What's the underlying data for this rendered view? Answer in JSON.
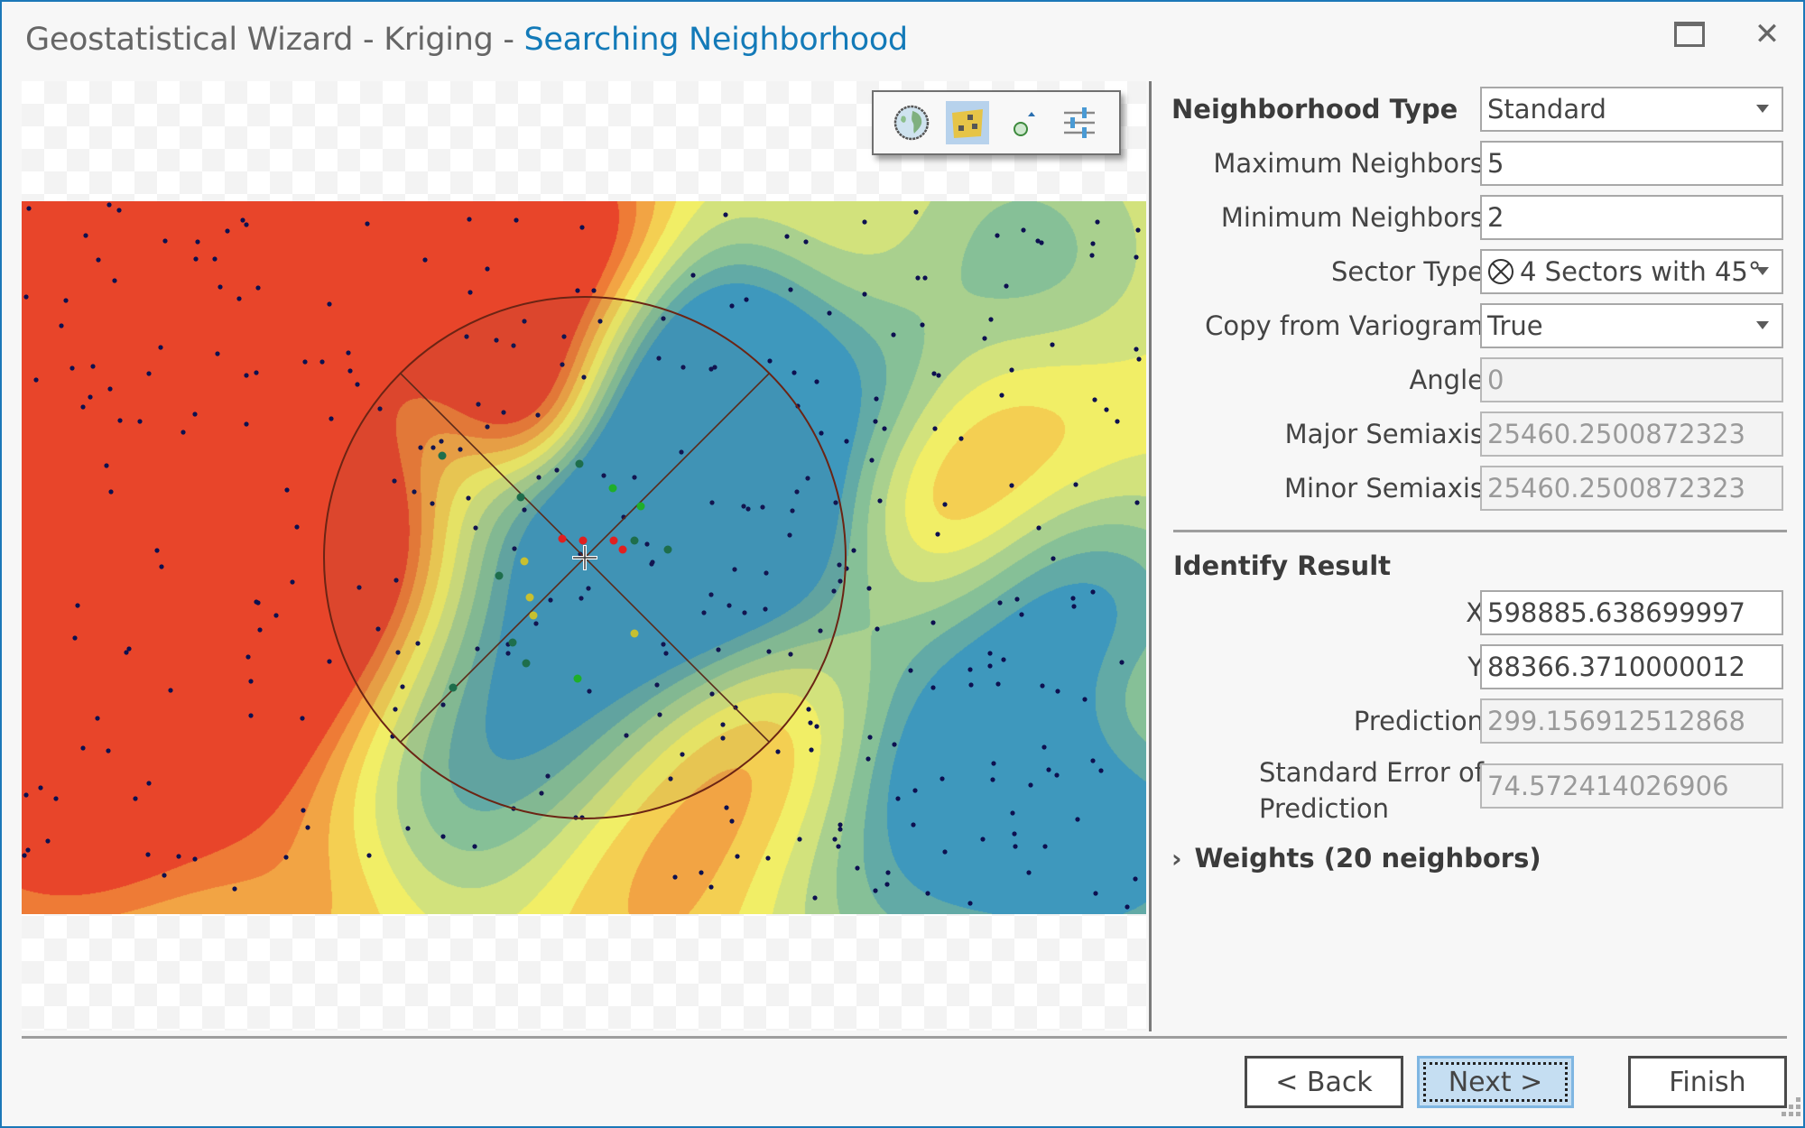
{
  "window": {
    "title_prefix": "Geostatistical Wizard - Kriging - ",
    "title_step": "Searching Neighborhood",
    "maximize_icon": "maximize-icon",
    "close_icon": "close-icon",
    "close_glyph": "✕"
  },
  "map_toolbar": {
    "buttons": [
      {
        "name": "full-extent-button",
        "icon": "globe-icon",
        "active": false
      },
      {
        "name": "show-points-button",
        "icon": "points-layer-icon",
        "active": true
      },
      {
        "name": "identify-location-button",
        "icon": "point-identify-icon",
        "active": false
      },
      {
        "name": "map-settings-button",
        "icon": "sliders-icon",
        "active": false
      }
    ]
  },
  "map": {
    "crosshair": "identify-crosshair",
    "search_shape": "circle",
    "sectors": 4,
    "sector_angle_deg": 45,
    "neighbor_point_colors": {
      "highest_weight": "#e02020",
      "high_weight": "#1fae2a",
      "medium_weight": "#1e6e4c",
      "low_weight": "#c8c030",
      "sample_point": "#0d1050"
    },
    "colormap": [
      "#e8452a",
      "#ee7b36",
      "#f2a444",
      "#f4cf52",
      "#f1ee66",
      "#d2e27c",
      "#a9d08e",
      "#86c097",
      "#62aaa6",
      "#3e98bd"
    ]
  },
  "form": {
    "neighborhood_type": {
      "label": "Neighborhood Type",
      "value": "Standard"
    },
    "max_neighbors": {
      "label": "Maximum Neighbors",
      "value": "5"
    },
    "min_neighbors": {
      "label": "Minimum Neighbors",
      "value": "2"
    },
    "sector_type": {
      "label": "Sector Type",
      "value": "4 Sectors with 45°",
      "icon": "sector-4-45-icon"
    },
    "copy_from_variogram": {
      "label": "Copy from Variogram",
      "value": "True"
    },
    "angle": {
      "label": "Angle",
      "value": "0"
    },
    "major_semiaxis": {
      "label": "Major Semiaxis",
      "value": "25460.2500872323"
    },
    "minor_semiaxis": {
      "label": "Minor Semiaxis",
      "value": "25460.2500872323"
    }
  },
  "identify": {
    "section_title": "Identify Result",
    "x": {
      "label": "X",
      "value": "598885.638699997"
    },
    "y": {
      "label": "Y",
      "value": "88366.3710000012"
    },
    "prediction": {
      "label": "Prediction",
      "value": "299.156912512868"
    },
    "std_error": {
      "label_line1": "Standard Error of",
      "label_line2": "Prediction",
      "value": "74.572414026906"
    },
    "weights": {
      "label": "Weights (20 neighbors)",
      "expanded": false
    }
  },
  "footer": {
    "back_label": "< Back",
    "next_label": "Next >",
    "finish_label": "Finish"
  }
}
